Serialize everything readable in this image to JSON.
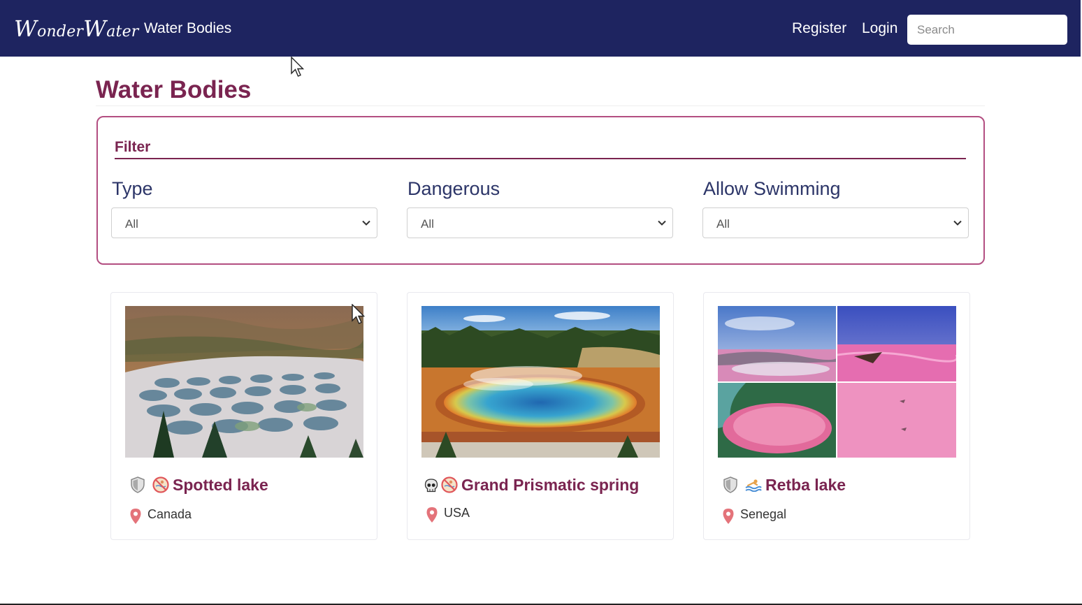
{
  "navbar": {
    "brand": {
      "w1": "W",
      "rest1": "onder",
      "w2": "W",
      "rest2": "ater"
    },
    "link_water_bodies": "Water Bodies",
    "register": "Register",
    "login": "Login",
    "search_placeholder": "Search"
  },
  "page": {
    "title": "Water Bodies"
  },
  "filter": {
    "legend": "Filter",
    "type": {
      "label": "Type",
      "value": "All"
    },
    "dangerous": {
      "label": "Dangerous",
      "value": "All"
    },
    "allow_swimming": {
      "label": "Allow Swimming",
      "value": "All"
    }
  },
  "cards": [
    {
      "name": "Spotted lake",
      "country": "Canada",
      "safety_icon": "shield-icon",
      "swim_icon": "no-swimming-icon"
    },
    {
      "name": "Grand Prismatic spring",
      "country": "USA",
      "safety_icon": "skull-icon",
      "swim_icon": "no-swimming-icon"
    },
    {
      "name": "Retba lake",
      "country": "Senegal",
      "safety_icon": "shield-icon",
      "swim_icon": "swimming-icon"
    }
  ],
  "colors": {
    "navbar": "#1e2460",
    "accent": "#7a2450",
    "label": "#2c3568",
    "pin": "#e4737a"
  }
}
